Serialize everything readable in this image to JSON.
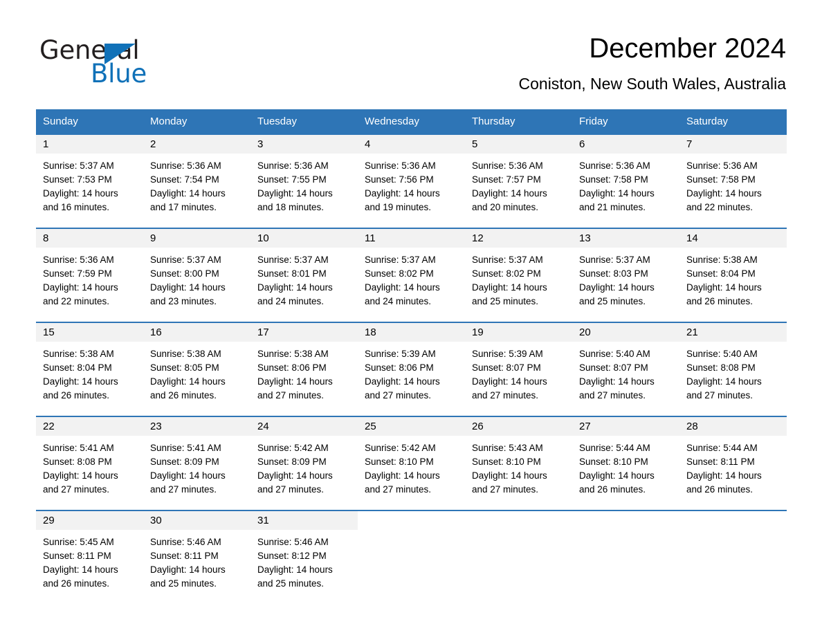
{
  "brand": {
    "name_part1": "General",
    "name_part2": "Blue",
    "triangle_color": "#1071b8",
    "logo_icon": "triangle-icon"
  },
  "header": {
    "title": "December 2024",
    "subtitle": "Coniston, New South Wales, Australia"
  },
  "colors": {
    "header_blue": "#2e75b6",
    "daynum_band": "#f2f2f2",
    "brand_blue": "#1071b8"
  },
  "weekday_headers": [
    "Sunday",
    "Monday",
    "Tuesday",
    "Wednesday",
    "Thursday",
    "Friday",
    "Saturday"
  ],
  "weeks": [
    [
      {
        "day": "1",
        "sunrise": "Sunrise: 5:37 AM",
        "sunset": "Sunset: 7:53 PM",
        "daylight_line1": "Daylight: 14 hours",
        "daylight_line2": "and 16 minutes."
      },
      {
        "day": "2",
        "sunrise": "Sunrise: 5:36 AM",
        "sunset": "Sunset: 7:54 PM",
        "daylight_line1": "Daylight: 14 hours",
        "daylight_line2": "and 17 minutes."
      },
      {
        "day": "3",
        "sunrise": "Sunrise: 5:36 AM",
        "sunset": "Sunset: 7:55 PM",
        "daylight_line1": "Daylight: 14 hours",
        "daylight_line2": "and 18 minutes."
      },
      {
        "day": "4",
        "sunrise": "Sunrise: 5:36 AM",
        "sunset": "Sunset: 7:56 PM",
        "daylight_line1": "Daylight: 14 hours",
        "daylight_line2": "and 19 minutes."
      },
      {
        "day": "5",
        "sunrise": "Sunrise: 5:36 AM",
        "sunset": "Sunset: 7:57 PM",
        "daylight_line1": "Daylight: 14 hours",
        "daylight_line2": "and 20 minutes."
      },
      {
        "day": "6",
        "sunrise": "Sunrise: 5:36 AM",
        "sunset": "Sunset: 7:58 PM",
        "daylight_line1": "Daylight: 14 hours",
        "daylight_line2": "and 21 minutes."
      },
      {
        "day": "7",
        "sunrise": "Sunrise: 5:36 AM",
        "sunset": "Sunset: 7:58 PM",
        "daylight_line1": "Daylight: 14 hours",
        "daylight_line2": "and 22 minutes."
      }
    ],
    [
      {
        "day": "8",
        "sunrise": "Sunrise: 5:36 AM",
        "sunset": "Sunset: 7:59 PM",
        "daylight_line1": "Daylight: 14 hours",
        "daylight_line2": "and 22 minutes."
      },
      {
        "day": "9",
        "sunrise": "Sunrise: 5:37 AM",
        "sunset": "Sunset: 8:00 PM",
        "daylight_line1": "Daylight: 14 hours",
        "daylight_line2": "and 23 minutes."
      },
      {
        "day": "10",
        "sunrise": "Sunrise: 5:37 AM",
        "sunset": "Sunset: 8:01 PM",
        "daylight_line1": "Daylight: 14 hours",
        "daylight_line2": "and 24 minutes."
      },
      {
        "day": "11",
        "sunrise": "Sunrise: 5:37 AM",
        "sunset": "Sunset: 8:02 PM",
        "daylight_line1": "Daylight: 14 hours",
        "daylight_line2": "and 24 minutes."
      },
      {
        "day": "12",
        "sunrise": "Sunrise: 5:37 AM",
        "sunset": "Sunset: 8:02 PM",
        "daylight_line1": "Daylight: 14 hours",
        "daylight_line2": "and 25 minutes."
      },
      {
        "day": "13",
        "sunrise": "Sunrise: 5:37 AM",
        "sunset": "Sunset: 8:03 PM",
        "daylight_line1": "Daylight: 14 hours",
        "daylight_line2": "and 25 minutes."
      },
      {
        "day": "14",
        "sunrise": "Sunrise: 5:38 AM",
        "sunset": "Sunset: 8:04 PM",
        "daylight_line1": "Daylight: 14 hours",
        "daylight_line2": "and 26 minutes."
      }
    ],
    [
      {
        "day": "15",
        "sunrise": "Sunrise: 5:38 AM",
        "sunset": "Sunset: 8:04 PM",
        "daylight_line1": "Daylight: 14 hours",
        "daylight_line2": "and 26 minutes."
      },
      {
        "day": "16",
        "sunrise": "Sunrise: 5:38 AM",
        "sunset": "Sunset: 8:05 PM",
        "daylight_line1": "Daylight: 14 hours",
        "daylight_line2": "and 26 minutes."
      },
      {
        "day": "17",
        "sunrise": "Sunrise: 5:38 AM",
        "sunset": "Sunset: 8:06 PM",
        "daylight_line1": "Daylight: 14 hours",
        "daylight_line2": "and 27 minutes."
      },
      {
        "day": "18",
        "sunrise": "Sunrise: 5:39 AM",
        "sunset": "Sunset: 8:06 PM",
        "daylight_line1": "Daylight: 14 hours",
        "daylight_line2": "and 27 minutes."
      },
      {
        "day": "19",
        "sunrise": "Sunrise: 5:39 AM",
        "sunset": "Sunset: 8:07 PM",
        "daylight_line1": "Daylight: 14 hours",
        "daylight_line2": "and 27 minutes."
      },
      {
        "day": "20",
        "sunrise": "Sunrise: 5:40 AM",
        "sunset": "Sunset: 8:07 PM",
        "daylight_line1": "Daylight: 14 hours",
        "daylight_line2": "and 27 minutes."
      },
      {
        "day": "21",
        "sunrise": "Sunrise: 5:40 AM",
        "sunset": "Sunset: 8:08 PM",
        "daylight_line1": "Daylight: 14 hours",
        "daylight_line2": "and 27 minutes."
      }
    ],
    [
      {
        "day": "22",
        "sunrise": "Sunrise: 5:41 AM",
        "sunset": "Sunset: 8:08 PM",
        "daylight_line1": "Daylight: 14 hours",
        "daylight_line2": "and 27 minutes."
      },
      {
        "day": "23",
        "sunrise": "Sunrise: 5:41 AM",
        "sunset": "Sunset: 8:09 PM",
        "daylight_line1": "Daylight: 14 hours",
        "daylight_line2": "and 27 minutes."
      },
      {
        "day": "24",
        "sunrise": "Sunrise: 5:42 AM",
        "sunset": "Sunset: 8:09 PM",
        "daylight_line1": "Daylight: 14 hours",
        "daylight_line2": "and 27 minutes."
      },
      {
        "day": "25",
        "sunrise": "Sunrise: 5:42 AM",
        "sunset": "Sunset: 8:10 PM",
        "daylight_line1": "Daylight: 14 hours",
        "daylight_line2": "and 27 minutes."
      },
      {
        "day": "26",
        "sunrise": "Sunrise: 5:43 AM",
        "sunset": "Sunset: 8:10 PM",
        "daylight_line1": "Daylight: 14 hours",
        "daylight_line2": "and 27 minutes."
      },
      {
        "day": "27",
        "sunrise": "Sunrise: 5:44 AM",
        "sunset": "Sunset: 8:10 PM",
        "daylight_line1": "Daylight: 14 hours",
        "daylight_line2": "and 26 minutes."
      },
      {
        "day": "28",
        "sunrise": "Sunrise: 5:44 AM",
        "sunset": "Sunset: 8:11 PM",
        "daylight_line1": "Daylight: 14 hours",
        "daylight_line2": "and 26 minutes."
      }
    ],
    [
      {
        "day": "29",
        "sunrise": "Sunrise: 5:45 AM",
        "sunset": "Sunset: 8:11 PM",
        "daylight_line1": "Daylight: 14 hours",
        "daylight_line2": "and 26 minutes."
      },
      {
        "day": "30",
        "sunrise": "Sunrise: 5:46 AM",
        "sunset": "Sunset: 8:11 PM",
        "daylight_line1": "Daylight: 14 hours",
        "daylight_line2": "and 25 minutes."
      },
      {
        "day": "31",
        "sunrise": "Sunrise: 5:46 AM",
        "sunset": "Sunset: 8:12 PM",
        "daylight_line1": "Daylight: 14 hours",
        "daylight_line2": "and 25 minutes."
      },
      null,
      null,
      null,
      null
    ]
  ]
}
